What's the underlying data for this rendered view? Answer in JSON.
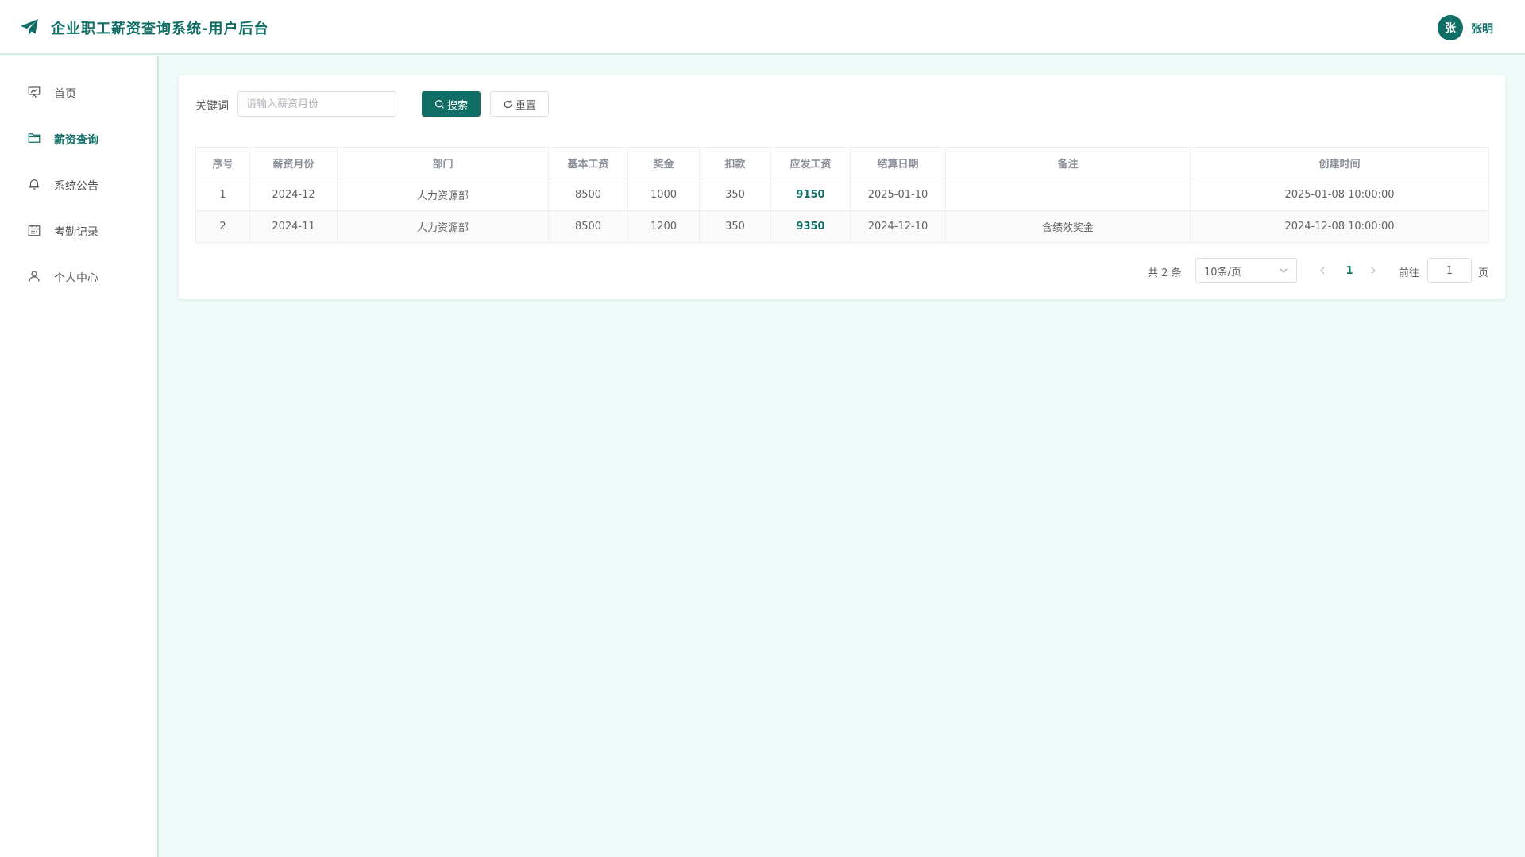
{
  "header": {
    "title": "企业职工薪资查询系统-用户后台",
    "avatar_initial": "张",
    "user_name": "张明"
  },
  "sidebar": {
    "items": [
      {
        "label": "首页",
        "icon": "presentation-chart-icon"
      },
      {
        "label": "薪资查询",
        "icon": "folder-icon",
        "active": true
      },
      {
        "label": "系统公告",
        "icon": "bell-icon"
      },
      {
        "label": "考勤记录",
        "icon": "calendar-icon"
      },
      {
        "label": "个人中心",
        "icon": "user-icon"
      }
    ]
  },
  "search": {
    "label": "关键词",
    "placeholder": "请输入薪资月份",
    "value": "",
    "search_button": "搜索",
    "reset_button": "重置"
  },
  "table": {
    "columns": [
      "序号",
      "薪资月份",
      "部门",
      "基本工资",
      "奖金",
      "扣款",
      "应发工资",
      "结算日期",
      "备注",
      "创建时间"
    ],
    "rows": [
      [
        "1",
        "2024-12",
        "人力资源部",
        "8500",
        "1000",
        "350",
        "9150",
        "2025-01-10",
        "",
        "2025-01-08 10:00:00"
      ],
      [
        "2",
        "2024-11",
        "人力资源部",
        "8500",
        "1200",
        "350",
        "9350",
        "2024-12-10",
        "含绩效奖金",
        "2024-12-08 10:00:00"
      ]
    ]
  },
  "pagination": {
    "total_text": "共 2 条",
    "page_size": "10条/页",
    "current_page": "1",
    "goto_label": "前往",
    "goto_value": "1",
    "page_suffix": "页"
  },
  "colors": {
    "accent": "#116e66",
    "background": "#f0fbf9"
  }
}
